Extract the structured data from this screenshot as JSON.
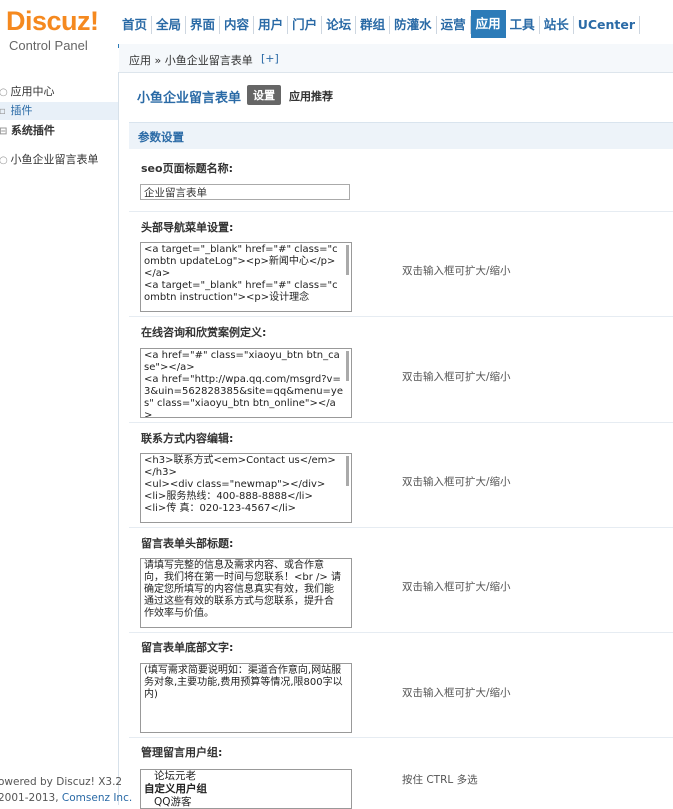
{
  "app": {
    "brand": "Discuz!",
    "subtitle": "Control Panel"
  },
  "topnav": {
    "items": [
      "首页",
      "全局",
      "界面",
      "内容",
      "用户",
      "门户",
      "论坛",
      "群组",
      "防灌水",
      "运营",
      "应用",
      "工具",
      "站长",
      "UCenter"
    ],
    "active_index": 10
  },
  "breadcrumb": {
    "text": "应用 » 小鱼企业留言表单",
    "add_label": "[+]"
  },
  "sidebar": {
    "items": [
      {
        "label": "应用中心",
        "icon": "circle-icon"
      },
      {
        "label": "插件",
        "icon": "plugin-icon",
        "active": true
      },
      {
        "label": "系统插件",
        "icon": "minus-box-icon",
        "bold": true
      },
      {
        "label": "小鱼企业留言表单",
        "icon": "circle-icon"
      }
    ]
  },
  "footer": {
    "powered": "owered by Discuz! X3.2",
    "copyright": " 2001-2013, ",
    "company": "Comsenz Inc."
  },
  "page": {
    "title": "小鱼企业留言表单",
    "tab_settings": "设置",
    "tab_recommend": "应用推荐",
    "section": "参数设置"
  },
  "fields": {
    "seo_label": "seo页面标题名称:",
    "seo_value": "企业留言表单",
    "nav_label": "头部导航菜单设置:",
    "nav_value": "<a target=\"_blank\" href=\"#\" class=\"combtn updateLog\"><p>新闻中心</p></a>\n<a target=\"_blank\" href=\"#\" class=\"combtn instruction\"><p>设计理念",
    "online_label": "在线咨询和欣赏案例定义:",
    "online_value": "<a href=\"#\" class=\"xiaoyu_btn btn_case\"></a>\n<a href=\"http://wpa.qq.com/msgrd?v=3&uin=562828385&site=qq&menu=yes\" class=\"xiaoyu_btn btn_online\"></a>",
    "contact_label": "联系方式内容编辑:",
    "contact_value": "<h3>联系方式<em>Contact us</em></h3>\n<ul><div class=\"newmap\"></div>\n<li>服务热线：400-888-8888</li>\n<li>传 真：020-123-4567</li>",
    "form_title_label": "留言表单头部标题:",
    "form_title_value": "请填写完整的信息及需求内容、或合作意向，我们将在第一时间与您联系！<br /> 请确定您所填写的内容信息真实有效，我们能通过这些有效的联系方式与您联系，提升合作效率与价值。",
    "form_footer_label": "留言表单底部文字:",
    "form_footer_value": "(填写需求简要说明如：渠道合作意向,网站服务对象,主要功能,费用预算等情况,限800字以内)",
    "hint_resize": "双击输入框可扩大/缩小",
    "group_label": "管理留言用户组:",
    "group_hint": "按住 CTRL 多选",
    "group_options": [
      "论坛元老",
      "自定义用户组",
      "QQ游客"
    ]
  }
}
